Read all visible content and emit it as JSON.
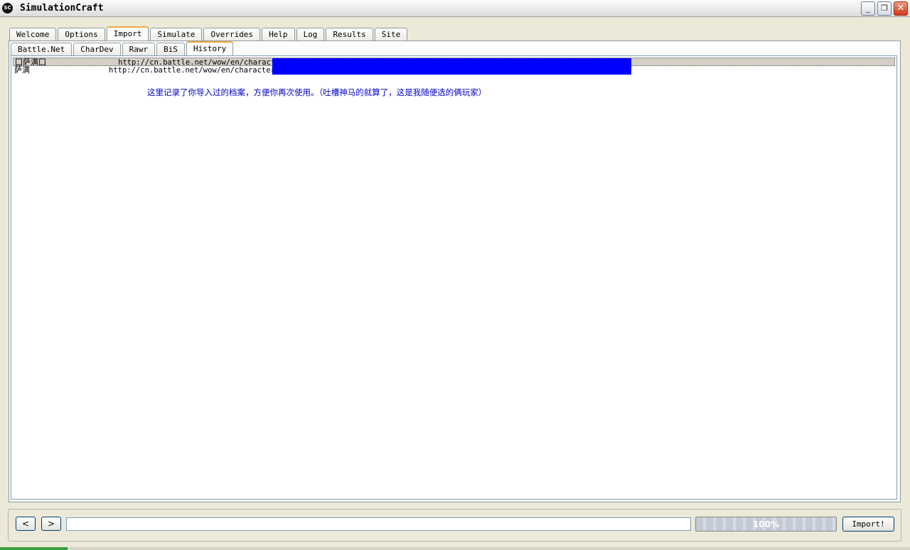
{
  "window": {
    "title": "SimulationCraft",
    "icon_text": "SC",
    "min_label": "_",
    "max_label": "❐",
    "close_label": "✕"
  },
  "main_tabs": [
    {
      "label": "Welcome"
    },
    {
      "label": "Options"
    },
    {
      "label": "Import"
    },
    {
      "label": "Simulate"
    },
    {
      "label": "Overrides"
    },
    {
      "label": "Help"
    },
    {
      "label": "Log"
    },
    {
      "label": "Results"
    },
    {
      "label": "Site"
    }
  ],
  "active_main_tab": "Import",
  "sub_tabs": [
    {
      "label": "Battle.Net"
    },
    {
      "label": "CharDev"
    },
    {
      "label": "Rawr"
    },
    {
      "label": "BiS"
    },
    {
      "label": "History"
    }
  ],
  "active_sub_tab": "History",
  "history": {
    "rows": [
      {
        "name": "囗萨满囗",
        "url": "http://cn.battle.net/wow/en/character"
      },
      {
        "name": "萨满",
        "url": "http://cn.battle.net/wow/en/character/%"
      }
    ],
    "note": "这里记录了你导入过的档案，方便你再次使用。（吐槽神马的就算了，这是我随便选的俩玩家）"
  },
  "bottom": {
    "back_label": "<",
    "forward_label": ">",
    "url_value": "",
    "progress_text": "100%",
    "progress": 1.0,
    "import_label": "Import!"
  },
  "colors": {
    "redaction": "#0000ff",
    "note_text": "#0000c8",
    "active_tab_accent": "#f2a83b"
  }
}
